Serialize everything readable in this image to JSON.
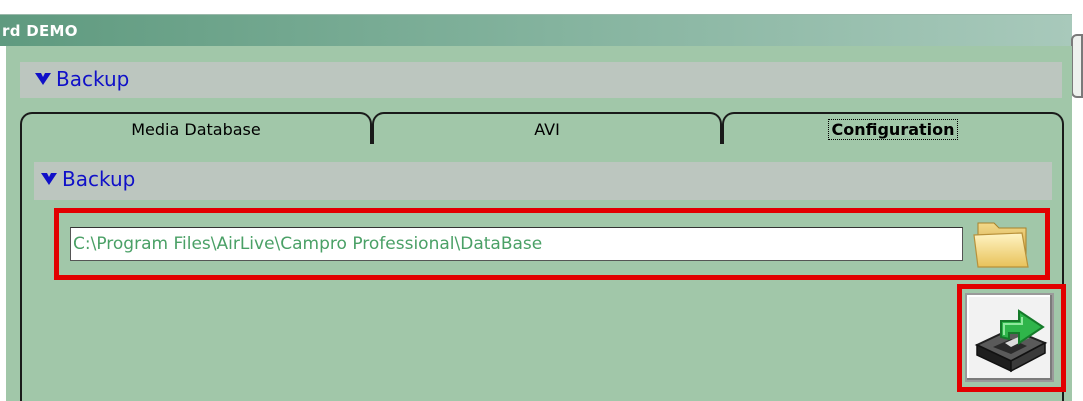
{
  "window": {
    "title": "rd DEMO"
  },
  "sections": {
    "outer_title": "Backup",
    "inner_title": "Backup",
    "collapse_glyph": "▿"
  },
  "tabs": [
    {
      "label": "Media Database",
      "active": false
    },
    {
      "label": "AVI",
      "active": false
    },
    {
      "label": "Configuration",
      "active": true
    }
  ],
  "backup": {
    "path_value": "C:\\Program Files\\AirLive\\Campro Professional\\DataBase",
    "browse_icon": "folder-icon",
    "action_icon": "drive-export-icon"
  },
  "colors": {
    "highlight": "#e20000",
    "section_text": "#1010c8",
    "panel_bg": "#a1c7a9",
    "path_text": "#4aa066"
  }
}
